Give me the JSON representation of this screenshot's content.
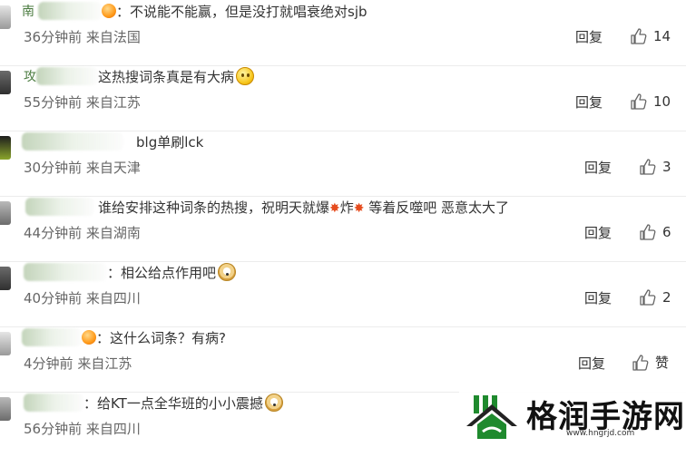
{
  "comments": [
    {
      "name_visible": "南",
      "text": "：不说能不能赢，但是没打就唱衰绝对sjb",
      "time": "36分钟前",
      "location": "来自法国",
      "reply_label": "回复",
      "likes": "14"
    },
    {
      "name_visible": "攻",
      "text": "这热搜词条真是有大病",
      "time": "55分钟前",
      "location": "来自江苏",
      "reply_label": "回复",
      "likes": "10"
    },
    {
      "name_visible": "",
      "text": "blg单刷lck",
      "time": "30分钟前",
      "location": "来自天津",
      "reply_label": "回复",
      "likes": "3"
    },
    {
      "name_visible": "",
      "text_a": "谁给安排这种词条的热搜，祝明天就爆",
      "text_b": "炸",
      "text_c": "等着反噬吧 恶意太大了",
      "time": "44分钟前",
      "location": "来自湖南",
      "reply_label": "回复",
      "likes": "6"
    },
    {
      "name_visible": "",
      "text": "：相公给点作用吧",
      "time": "40分钟前",
      "location": "来自四川",
      "reply_label": "回复",
      "likes": "2"
    },
    {
      "name_visible": "",
      "text": "：这什么词条？有病?",
      "time": "4分钟前",
      "location": "来自江苏",
      "reply_label": "回复",
      "likes": "赞"
    },
    {
      "name_visible": "",
      "text": "：给KT一点全华班的小小震撼",
      "time": "56分钟前",
      "location": "来自四川",
      "reply_label": "",
      "likes": ""
    }
  ],
  "watermark": {
    "title": "格润手游网",
    "url": "www.hngrjd.com"
  },
  "colors": {
    "accent_green": "#4a7b3f",
    "meta_gray": "#666666",
    "divider": "#ececec"
  },
  "icons": {
    "like": "thumbs-up-icon",
    "badge": "vip-badge-icon",
    "emoji_smile": "smile-emoji-icon",
    "emoji_dog": "doge-emoji-icon",
    "emoji_explosion": "explosion-emoji-icon"
  }
}
